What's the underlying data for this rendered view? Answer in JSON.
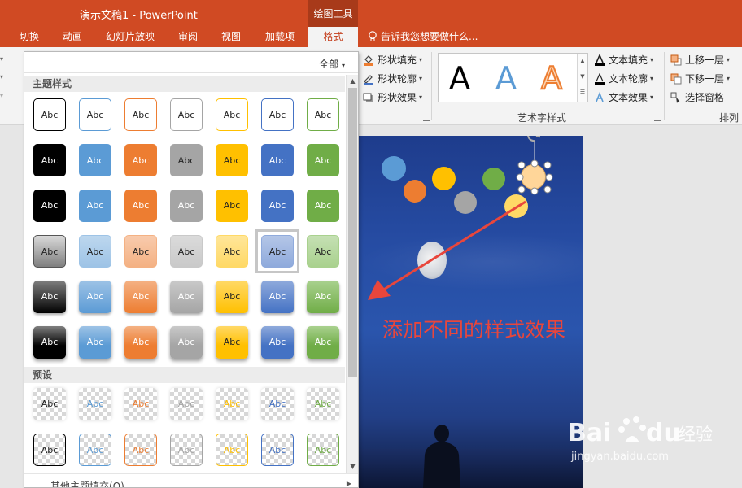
{
  "app": {
    "document_title": "演示文稿1 - PowerPoint",
    "context_tab_group": "绘图工具"
  },
  "tabs": [
    {
      "label": "切换",
      "active": false
    },
    {
      "label": "动画",
      "active": false
    },
    {
      "label": "幻灯片放映",
      "active": false
    },
    {
      "label": "审阅",
      "active": false
    },
    {
      "label": "视图",
      "active": false
    },
    {
      "label": "加载项",
      "active": false
    },
    {
      "label": "格式",
      "active": true
    }
  ],
  "tell_me": "告诉我您想要做什么...",
  "ribbon": {
    "shape_fill": "形状填充",
    "shape_outline": "形状轮廓",
    "shape_effects": "形状效果",
    "wordart_letters": [
      "A",
      "A",
      "A"
    ],
    "wordart_group_label": "艺术字样式",
    "text_fill": "文本填充",
    "text_outline": "文本轮廓",
    "text_effects": "文本效果",
    "bring_forward": "上移一层",
    "send_backward": "下移一层",
    "selection_pane": "选择窗格",
    "arrange_group_label": "排列"
  },
  "gallery": {
    "filter_label": "全部",
    "theme_section": "主题样式",
    "preset_section": "预设",
    "more_fills": "其他主题填充(O)",
    "swatch_text": "Abc",
    "theme_colors": [
      "#000000",
      "#5b9bd5",
      "#ed7d31",
      "#a5a5a5",
      "#ffc000",
      "#4472c4",
      "#70ad47"
    ],
    "selected": {
      "row": 4,
      "col": 5
    }
  },
  "slide": {
    "annotation": "添加不同的样式效果"
  },
  "watermark": {
    "logo": "Baidu经验",
    "url": "jingyan.baidu.com"
  },
  "colors": {
    "accent": "#d04a23",
    "arrow": "#e8463c"
  }
}
